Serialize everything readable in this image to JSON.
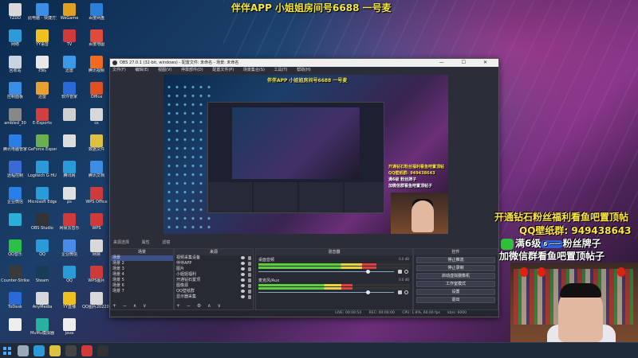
{
  "banner": "伴伴APP 小姐姐房间号6688 一号麦",
  "desktop_icons": [
    {
      "label": "YZDD",
      "color": "#d9d9d9"
    },
    {
      "label": "此电脑 - 快捷方式",
      "color": "#3a8ee6"
    },
    {
      "label": "WeGame",
      "color": "#e0a020"
    },
    {
      "label": "百度网盘",
      "color": "#2a7fd8"
    },
    {
      "label": "网络",
      "color": "#2e9bd8"
    },
    {
      "label": "YY语音",
      "color": "#f0c020"
    },
    {
      "label": "TV",
      "color": "#d03a3a"
    },
    {
      "label": "百度地图",
      "color": "#e04a3a"
    },
    {
      "label": "回收站",
      "color": "#c8d4e0"
    },
    {
      "label": "扫码",
      "color": "#e8e8e8"
    },
    {
      "label": "迅雷",
      "color": "#3a9ae8"
    },
    {
      "label": "腾讯视频",
      "color": "#f06a20"
    },
    {
      "label": "控制面板",
      "color": "#3a8ee6"
    },
    {
      "label": "迅雷",
      "color": "#e8a030"
    },
    {
      "label": "软件管家",
      "color": "#2a6ad8"
    },
    {
      "label": "Office",
      "color": "#e05020"
    },
    {
      "label": "ambled_30",
      "color": "#888888"
    },
    {
      "label": "E-Exports",
      "color": "#d04040"
    },
    {
      "label": "",
      "color": "#d0d0d0"
    },
    {
      "label": "cs",
      "color": "#d8d8d8"
    },
    {
      "label": "腾讯电脑管家",
      "color": "#2a7ee8"
    },
    {
      "label": "GeForce Experience",
      "color": "#6ab04c"
    },
    {
      "label": "",
      "color": "#dddddd"
    },
    {
      "label": "数据文件",
      "color": "#e0c040"
    },
    {
      "label": "远程控制",
      "color": "#3a6ad8"
    },
    {
      "label": "Logitech G HUB",
      "color": "#2a9ad8"
    },
    {
      "label": "腾讯网",
      "color": "#2a9ad8"
    },
    {
      "label": "腾讯文档",
      "color": "#3a8ee6"
    },
    {
      "label": "企业微信",
      "color": "#2a7ee8"
    },
    {
      "label": "Microsoft Edge",
      "color": "#2a9ad8"
    },
    {
      "label": "ps",
      "color": "#e0e0e0"
    },
    {
      "label": "WPS Office",
      "color": "#d03a3a"
    },
    {
      "label": "",
      "color": "#2ab0d8"
    },
    {
      "label": "OBS Studio",
      "color": "#333333"
    },
    {
      "label": "网易云音乐",
      "color": "#d03a3a"
    },
    {
      "label": "WPS",
      "color": "#d03a3a"
    },
    {
      "label": "QQ音乐",
      "color": "#2ac04a"
    },
    {
      "label": "QQ",
      "color": "#2a9ad8"
    },
    {
      "label": "企业微信",
      "color": "#4a8ae8"
    },
    {
      "label": "网易",
      "color": "#d8d8d8"
    },
    {
      "label": "Counter-Strike",
      "color": "#3a3a3a"
    },
    {
      "label": "Steam",
      "color": "#1a3a5a"
    },
    {
      "label": "QQ",
      "color": "#2a9ad8"
    },
    {
      "label": "WPS图片",
      "color": "#d03a3a"
    },
    {
      "label": "ToDesk",
      "color": "#2a6ad8"
    },
    {
      "label": "AnyMedia",
      "color": "#d8d8d8"
    },
    {
      "label": "YY直播",
      "color": "#f0c020"
    },
    {
      "label": "QQ图片20220305",
      "color": "#d8d8d8"
    },
    {
      "label": "",
      "color": "#eeeeee"
    },
    {
      "label": "MuMu模拟器",
      "color": "#2ab0a0"
    },
    {
      "label": "java",
      "color": "#eeeeee"
    }
  ],
  "promo": {
    "line1": "开通钻石粉丝福利看鱼吧置顶帖",
    "line2": "QQ壁纸群: 949438643",
    "line3_prefix": "满6级",
    "line3_badge": "6 一一",
    "line3_suffix": "粉丝牌子",
    "line4": "加微信群看鱼吧置顶帖子"
  },
  "obs": {
    "title": "OBS 27.0.1 (32-bit, windows) - 配置文件: 未命名 - 场景: 未命名",
    "window_buttons": "— ☐ ✕",
    "menu": [
      "文件(F)",
      "编辑(E)",
      "视图(V)",
      "停靠部件(D)",
      "配置文件(P)",
      "场景集合(S)",
      "工具(T)",
      "帮助(H)"
    ],
    "preview": {
      "title": "伴伴APP 小姐姐房间号6688 一号麦",
      "promo_line1": "开通钻石粉丝福利看鱼吧置顶帖",
      "promo_line2": "QQ壁纸群: 949438643",
      "promo_line3": "满6级 粉丝牌子",
      "promo_line4": "加微信群看鱼吧置顶帖子"
    },
    "tabs": [
      "来源选择",
      "属性",
      "滤镜"
    ],
    "docks": {
      "scenes": {
        "header": "场景",
        "items": [
          "场景",
          "场景 2",
          "场景 3",
          "场景 4",
          "场景 5",
          "场景 6",
          "场景 7"
        ],
        "tools": "+ − ∧ ∨"
      },
      "sources": {
        "header": "来源",
        "items": [
          "视频采集设备",
          "伴伴APP",
          "图片",
          "小姐姐福利",
          "开通钻石置顶",
          "图像源",
          "QQ壁纸群",
          "显示器采集"
        ],
        "tools": "+ − ⚙ ∧ ∨"
      },
      "mixer": {
        "header": "混音器",
        "channels": [
          {
            "label": "桌面音频",
            "db": "0.0 dB",
            "level": 0.78,
            "volume": 0.82
          },
          {
            "label": "麦克风/Aux",
            "db": "0.0 dB",
            "level": 0.62,
            "volume": 0.82
          }
        ]
      },
      "controls": {
        "header": "控件",
        "buttons": [
          "停止推流",
          "停止录制",
          "启动虚拟摄像机",
          "工作室模式",
          "设置",
          "退出"
        ]
      }
    },
    "status": {
      "live": "LIVE: 00:00:54",
      "rec": "REC: 00:00:00",
      "cpu": "CPU: 1.8%, 60.00 fps",
      "bitrate": "kb/s: 6000"
    }
  },
  "taskbar": {
    "items": [
      {
        "name": "search",
        "color": "#9ab"
      },
      {
        "name": "edge",
        "color": "#2a9ad8"
      },
      {
        "name": "file-explorer",
        "color": "#e0c040"
      },
      {
        "name": "obs",
        "color": "#444444"
      },
      {
        "name": "app-g",
        "color": "#d03a3a"
      },
      {
        "name": "app-dark",
        "color": "#333333"
      }
    ]
  }
}
